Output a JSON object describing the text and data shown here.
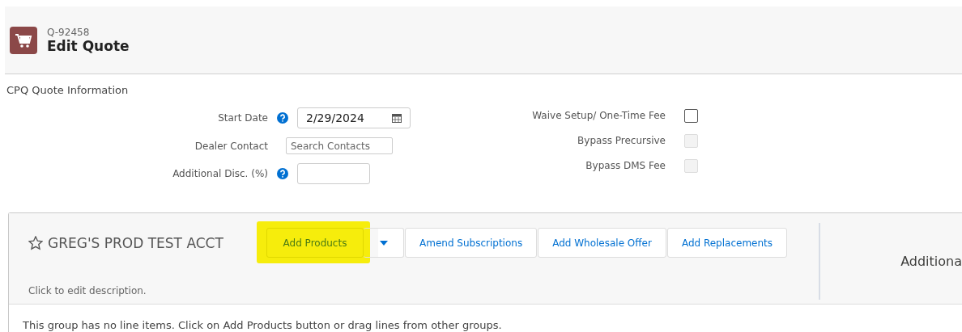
{
  "header": {
    "record_id": "Q-92458",
    "title": "Edit Quote"
  },
  "section": {
    "title": "CPQ Quote Information"
  },
  "left_fields": [
    {
      "kind": "date",
      "label": "Start Date",
      "help": true,
      "value": "2/29/2024"
    },
    {
      "kind": "search",
      "label": "Dealer Contact",
      "help": false,
      "placeholder": "Search Contacts"
    },
    {
      "kind": "text",
      "label": "Additional Disc. (%)",
      "help": true
    }
  ],
  "right_fields": [
    {
      "label": "Waive Setup/ One-Time Fee",
      "checked": false,
      "disabled": false
    },
    {
      "label": "Bypass Precursive",
      "checked": false,
      "disabled": true
    },
    {
      "label": "Bypass DMS Fee",
      "checked": false,
      "disabled": true
    }
  ],
  "group": {
    "name": "GREG'S PROD TEST ACCT",
    "favorite": false,
    "description": "Click to edit description.",
    "buttons": [
      {
        "kind": "split",
        "label": "Add Products",
        "highlighted": true
      },
      {
        "kind": "plain",
        "label": "Amend Subscriptions",
        "highlighted": false
      },
      {
        "kind": "plain",
        "label": "Add Wholesale Offer",
        "highlighted": false
      },
      {
        "kind": "plain",
        "label": "Add Replacements",
        "highlighted": false
      }
    ],
    "side_label": "Additiona",
    "empty_message": "This group has no line items. Click on Add Products button or drag lines from other groups."
  }
}
